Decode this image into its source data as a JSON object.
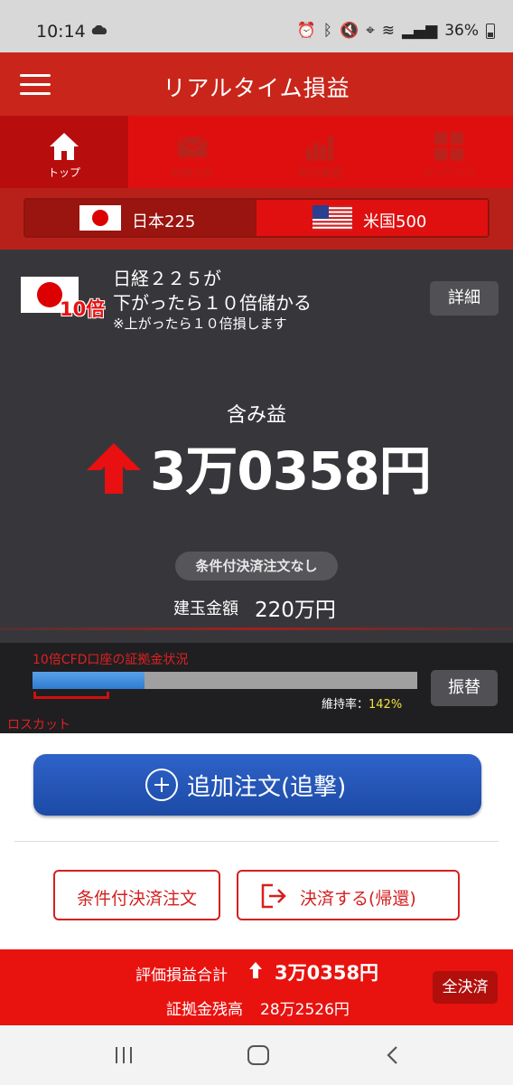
{
  "status_bar": {
    "time": "10:14",
    "battery": "36%"
  },
  "app_bar": {
    "title": "リアルタイム損益"
  },
  "tabs": [
    {
      "label": "トップ",
      "icon": "home-icon",
      "active": true
    },
    {
      "label": "お知らせ",
      "icon": "mail-icon",
      "active": false
    },
    {
      "label": "取引履歴",
      "icon": "bar-chart-icon",
      "active": false
    },
    {
      "label": "コンテンツ",
      "icon": "grid-icon",
      "active": false
    }
  ],
  "market_toggle": {
    "options": [
      {
        "label": "日本225",
        "flag": "japan-flag-icon",
        "active": true
      },
      {
        "label": "米国500",
        "flag": "us-flag-icon",
        "active": false
      }
    ]
  },
  "product": {
    "leverage_badge": "10倍",
    "line1": "日経２２５が",
    "line2": "下がったら１０倍儲かる",
    "note": "※上がったら１０倍損します",
    "detail_label": "詳細"
  },
  "pnl": {
    "label": "含み益",
    "value": "3万0358円",
    "direction": "up",
    "conditional_badge": "条件付決済注文なし",
    "position_label": "建玉金額",
    "position_value": "220万円"
  },
  "margin_status": {
    "title": "10倍CFD口座の証拠金状況",
    "ratio_label": "維持率：",
    "ratio_value": "142%",
    "bar_fill_fraction": 0.29,
    "transfer_label": "振替",
    "losscut_label": "ロスカット"
  },
  "actions": {
    "add_order_label": "追加注文(追撃)",
    "conditional_order_label": "条件付決済注文",
    "settle_label": "決済する(帰還)"
  },
  "footer": {
    "total_label": "評価損益合計",
    "total_value": "3万0358円",
    "balance_label": "証拠金残高",
    "balance_value": "28万2526円",
    "settle_all_label": "全決済"
  },
  "colors": {
    "brand_red": "#c9251a",
    "tab_red": "#e00f0f",
    "panel_dark": "#37373b",
    "action_blue": "#1c4aa6",
    "ratio_yellow": "#f2e23a"
  }
}
